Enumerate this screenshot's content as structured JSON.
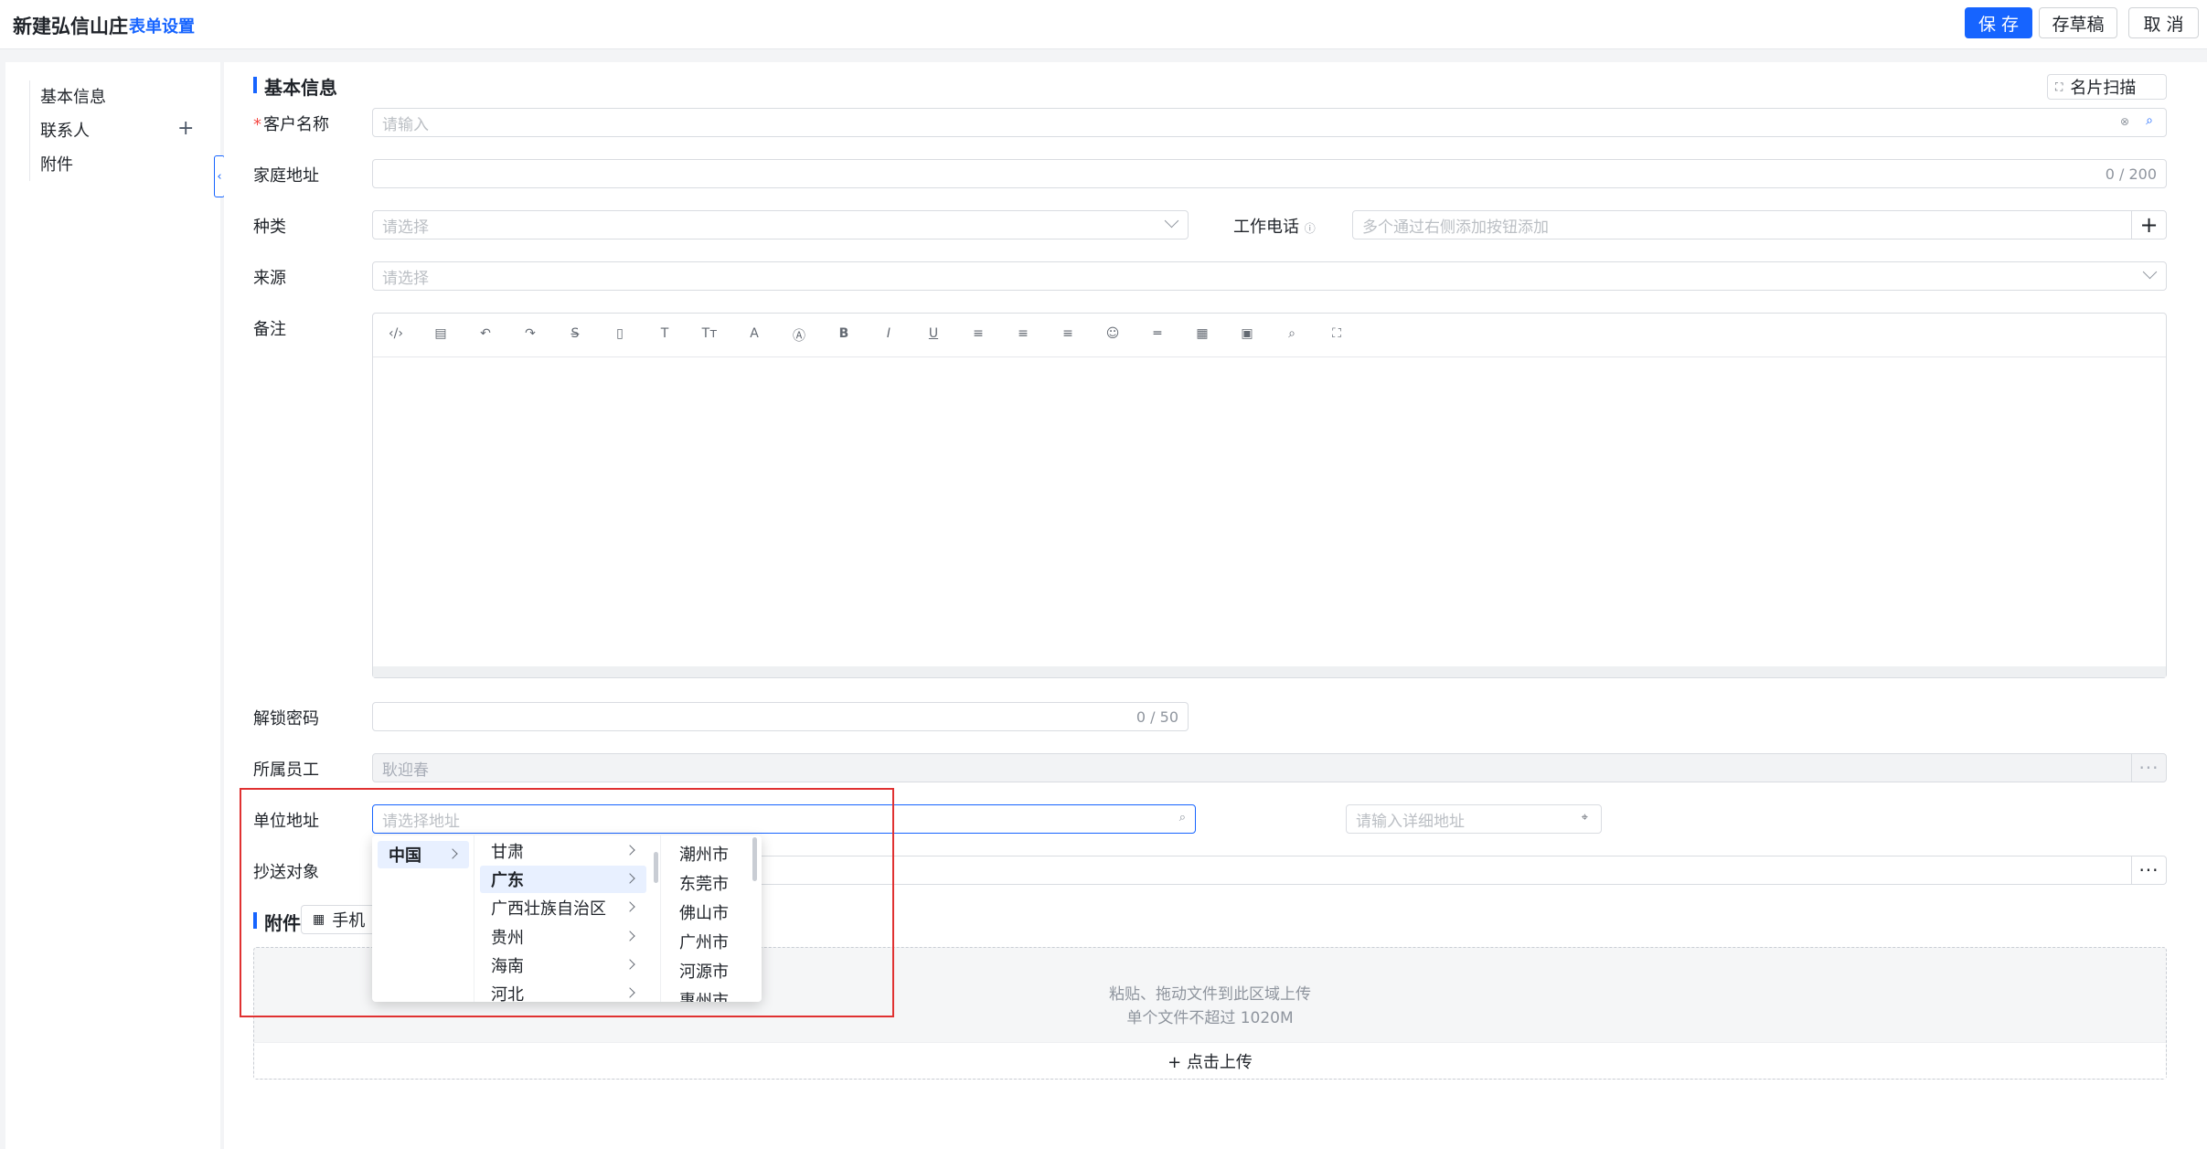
{
  "header": {
    "title": "新建弘信山庄",
    "form_settings": "表单设置",
    "save": "保 存",
    "draft": "存草稿",
    "cancel": "取 消"
  },
  "sidebar": {
    "items": [
      {
        "label": "基本信息"
      },
      {
        "label": "联系人"
      },
      {
        "label": "附件"
      }
    ],
    "add_icon": "+"
  },
  "basic_section": {
    "title": "基本信息",
    "card_scan": "名片扫描"
  },
  "fields": {
    "customer_name": {
      "label": "客户名称",
      "placeholder": "请输入"
    },
    "home_address": {
      "label": "家庭地址",
      "counter": "0 / 200"
    },
    "category": {
      "label": "种类",
      "placeholder": "请选择"
    },
    "work_phone": {
      "label": "工作电话",
      "placeholder": "多个通过右侧添加按钮添加",
      "add": "+"
    },
    "source": {
      "label": "来源",
      "placeholder": "请选择"
    },
    "remark": {
      "label": "备注"
    },
    "unlock_password": {
      "label": "解锁密码",
      "counter": "0 / 50"
    },
    "employee": {
      "label": "所属员工",
      "value": "耿迎春",
      "more": "···"
    },
    "company_address": {
      "label": "单位地址",
      "placeholder": "请选择地址",
      "detail_placeholder": "请输入详细地址"
    },
    "cc": {
      "label": "抄送对象",
      "more": "···"
    }
  },
  "toolbar_icons": [
    "code-icon",
    "template-icon",
    "undo-icon",
    "redo-icon",
    "strikethrough-icon",
    "document-icon",
    "font-size-icon",
    "heading-icon",
    "font-color-icon",
    "background-color-icon",
    "bold-icon",
    "italic-icon",
    "underline-icon",
    "align-left-icon",
    "align-center-icon",
    "align-right-icon",
    "emoji-icon",
    "horizontal-rule-icon",
    "table-icon",
    "image-icon",
    "attachment-icon",
    "fullscreen-icon"
  ],
  "toolbar_glyphs": [
    "‹/›",
    "▤",
    "↶",
    "↷",
    "S̶",
    "▯",
    "T",
    "Tт",
    "A",
    "Ⓐ",
    "B",
    "I",
    "U",
    "≡",
    "≡",
    "≡",
    "☺",
    "═",
    "▦",
    "▣",
    "⌕",
    "⛶"
  ],
  "attachment_section": {
    "title": "附件",
    "mobile_upload": "手机",
    "hint1": "粘贴、拖动文件到此区域上传",
    "hint2": "单个文件不超过 1020M",
    "upload": "+ 点击上传"
  },
  "cascader": {
    "countries": [
      "中国"
    ],
    "provinces": [
      "甘肃",
      "广东",
      "广西壮族自治区",
      "贵州",
      "海南",
      "河北"
    ],
    "cities": [
      "潮州市",
      "东莞市",
      "佛山市",
      "广州市",
      "河源市",
      "惠州市"
    ],
    "selected_country": "中国",
    "selected_province": "广东"
  },
  "colors": {
    "accent": "#1664ff",
    "highlight": "#e03131",
    "required": "#f54a45"
  }
}
